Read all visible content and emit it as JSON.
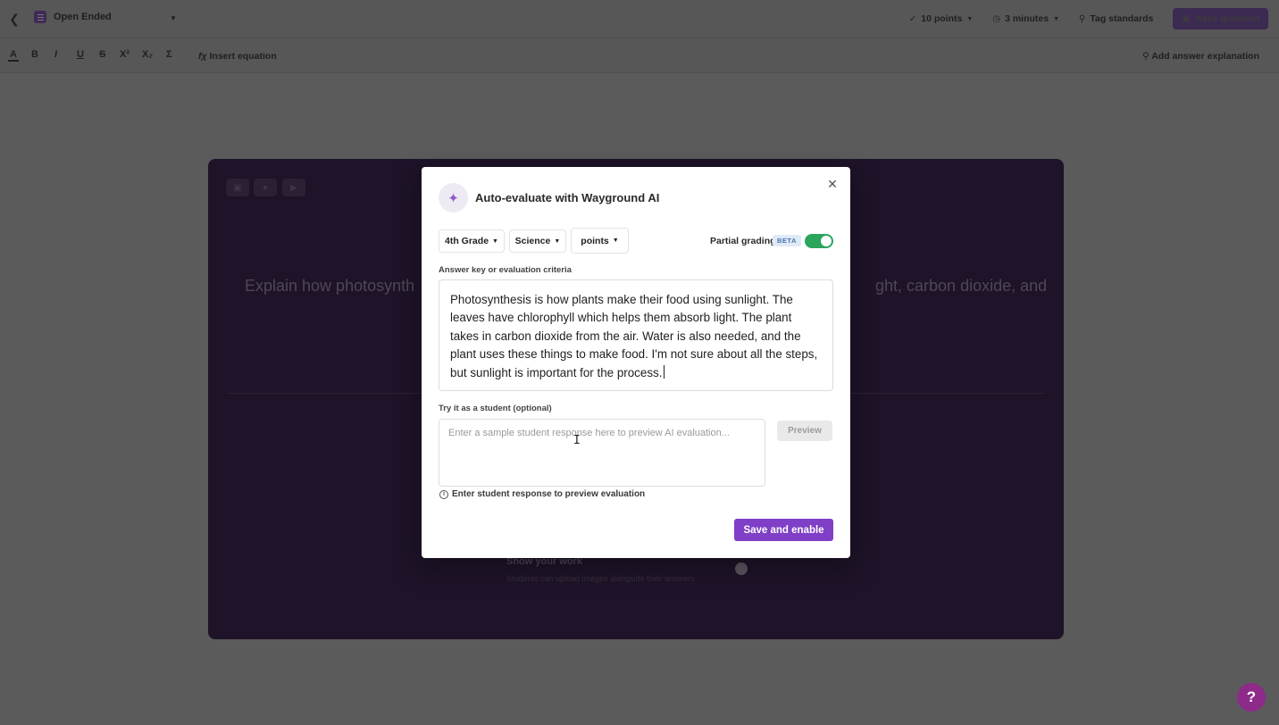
{
  "topbar": {
    "question_type": "Open Ended",
    "points": "10 points",
    "time": "3 minutes",
    "tag_standards": "Tag standards",
    "save_question": "Save question"
  },
  "toolbar": {
    "formats": [
      "A",
      "B",
      "I",
      "U",
      "S",
      "X²",
      "X₂",
      "Σ"
    ],
    "insert_equation": "Insert equation",
    "add_answer_explanation": "Add answer explanation"
  },
  "editor": {
    "question_visible_left": "Explain how photosynth",
    "question_visible_right": "ght, carbon dioxide, and",
    "show_your_work": "Show your work",
    "show_your_work_sub": "Students can upload images alongside their answers"
  },
  "modal": {
    "title": "Auto-evaluate with Wayground AI",
    "grade": "4th Grade",
    "subject": "Science",
    "scoring": "points",
    "partial_grading_label": "Partial grading",
    "beta_badge": "BETA",
    "partial_grading_enabled": true,
    "answer_key_label": "Answer key or evaluation criteria",
    "answer_key_text": "Photosynthesis is how plants make their food using sunlight. The leaves have chlorophyll which helps them absorb light. The plant takes in carbon dioxide from the air. Water is also needed, and the plant uses these things to make food. I'm not sure about all the steps, but sunlight is important for the process.",
    "try_student_label": "Try it as a student (optional)",
    "student_placeholder": "Enter a sample student response here to preview AI evaluation...",
    "preview_button": "Preview",
    "hint_text": "Enter student response to preview evaluation",
    "save_button": "Save and enable"
  },
  "help_button": "?",
  "colors": {
    "accent_purple": "#7f3fc6",
    "toggle_green": "#2aa55c",
    "help_magenta": "#8e2a8a"
  }
}
